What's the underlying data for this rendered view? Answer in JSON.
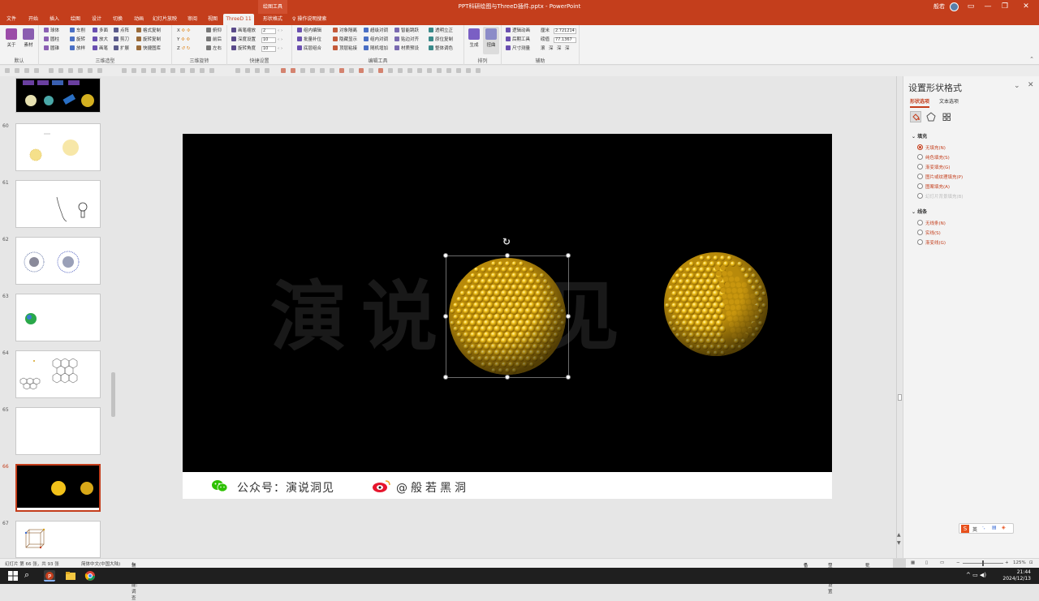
{
  "window": {
    "title": "PPT科研绘图与ThreeD插件.pptx - PowerPoint",
    "context_tab": "绘图工具",
    "user": "般若",
    "minimize": "—",
    "restore": "❐",
    "close": "✕"
  },
  "tabs": [
    "文件",
    "开始",
    "插入",
    "绘图",
    "设计",
    "切换",
    "动画",
    "幻灯片放映",
    "审阅",
    "视图",
    "ThreeD 11",
    "形状格式"
  ],
  "tell_me": "操作说明搜索",
  "ribbon": {
    "groups": [
      {
        "label": "默认",
        "items": [
          "关于",
          "素材"
        ]
      },
      {
        "label": "三维造型",
        "items": [
          "球体",
          "圆柱",
          "圆锥",
          "车削",
          "旋转",
          "放样",
          "多面",
          "放大",
          "画笔",
          "点阵",
          "剪刀",
          "扩展",
          "格式复制",
          "旋转复制",
          "快捷图库"
        ]
      },
      {
        "label": "三维旋转",
        "items": [
          "X",
          "Y",
          "Z",
          "前后",
          "左右",
          "俯仰"
        ]
      },
      {
        "label": "快捷设置",
        "items": [
          "画笔缩放",
          "深度设置",
          "旋转角度"
        ],
        "values": [
          "2",
          "10",
          "10"
        ]
      },
      {
        "label": "编辑工具",
        "items": [
          "组内编辑",
          "批量补位",
          "底层组合",
          "对象隔离",
          "隐藏显示",
          "顶层粘接",
          "超级对调",
          "组内对调",
          "随机增加",
          "智能跳跃",
          "贴边对齐",
          "材质预设",
          "透明立正",
          "原位复制",
          "整体调色"
        ]
      },
      {
        "label": "排列",
        "items": [
          "生成",
          "扭曲"
        ]
      },
      {
        "label": "辅助",
        "items": [
          "逻辑动画",
          "后期工具",
          "尺寸测量"
        ],
        "fields": [
          {
            "label": "厘米",
            "value": "2.721214"
          },
          {
            "label": "磅值",
            "value": "77.1367"
          }
        ],
        "extra": [
          "滚",
          "深",
          "深",
          "深"
        ]
      }
    ]
  },
  "slides": [
    {
      "num": "",
      "kind": "spheres-grid"
    },
    {
      "num": "60",
      "kind": "sun"
    },
    {
      "num": "61",
      "kind": "bulb"
    },
    {
      "num": "62",
      "kind": "urchins"
    },
    {
      "num": "63",
      "kind": "globe"
    },
    {
      "num": "64",
      "kind": "hex"
    },
    {
      "num": "65",
      "kind": "blank"
    },
    {
      "num": "66",
      "kind": "current"
    },
    {
      "num": "67",
      "kind": "lattice"
    }
  ],
  "slide": {
    "watermark": "演说洞见",
    "footer_wechat_label": "公众号：演说洞见",
    "footer_weibo_label": "@般若黑洞"
  },
  "format_pane": {
    "title": "设置形状格式",
    "tab_shape": "形状选项",
    "tab_text": "文本选项",
    "fill_section": "填充",
    "fill_options": [
      {
        "label": "无填充(N)",
        "checked": true,
        "disabled": false
      },
      {
        "label": "纯色填充(S)",
        "checked": false,
        "disabled": false
      },
      {
        "label": "渐变填充(G)",
        "checked": false,
        "disabled": false
      },
      {
        "label": "图片或纹理填充(P)",
        "checked": false,
        "disabled": false
      },
      {
        "label": "图案填充(A)",
        "checked": false,
        "disabled": false
      },
      {
        "label": "幻灯片背景填充(B)",
        "checked": false,
        "disabled": true
      }
    ],
    "line_section": "线条",
    "line_options": [
      {
        "label": "无线条(N)",
        "checked": false
      },
      {
        "label": "实线(S)",
        "checked": false
      },
      {
        "label": "渐变线(G)",
        "checked": false
      }
    ],
    "ime": "英"
  },
  "status": {
    "slide_count": "幻灯片 第 66 张，共 93 张",
    "language": "简体中文(中国大陆)",
    "accessibility": "辅助功能: 调查",
    "notes": "备注",
    "display": "显示器设置",
    "comments": "批注",
    "zoom": "125%"
  },
  "taskbar": {
    "time": "21:44",
    "date": "2024/12/13"
  },
  "colors": {
    "accent": "#c43e1c",
    "sphere": "#f2c21a"
  }
}
